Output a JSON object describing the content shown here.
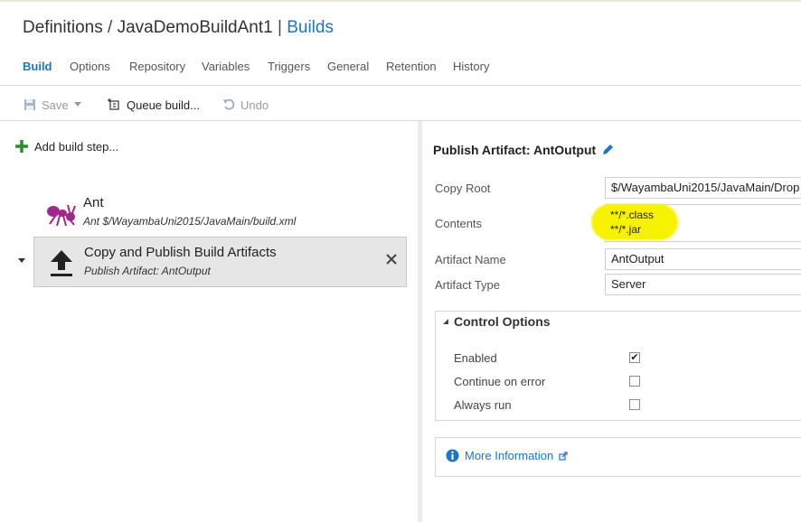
{
  "breadcrumb": {
    "root": "Definitions",
    "separator": "/",
    "definition": "JavaDemoBuildAnt1",
    "divider": "|",
    "builds_link": "Builds"
  },
  "tabs": [
    {
      "label": "Build",
      "active": true
    },
    {
      "label": "Options"
    },
    {
      "label": "Repository"
    },
    {
      "label": "Variables"
    },
    {
      "label": "Triggers"
    },
    {
      "label": "General"
    },
    {
      "label": "Retention"
    },
    {
      "label": "History"
    }
  ],
  "toolbar": {
    "save_label": "Save",
    "queue_label": "Queue build...",
    "undo_label": "Undo"
  },
  "left": {
    "add_step_label": "Add build step...",
    "steps": [
      {
        "title": "Ant",
        "subtitle": "Ant $/WayambaUni2015/JavaMain/build.xml",
        "icon": "ant-icon"
      },
      {
        "title": "Copy and Publish Build Artifacts",
        "subtitle": "Publish Artifact: AntOutput",
        "icon": "upload-icon",
        "selected": true
      }
    ]
  },
  "right": {
    "title": "Publish Artifact: AntOutput",
    "fields": {
      "copy_root_label": "Copy Root",
      "copy_root_value": "$/WayambaUni2015/JavaMain/Drop",
      "contents_label": "Contents",
      "contents_line1": "**/*.class",
      "contents_line2": "**/*.jar",
      "artifact_name_label": "Artifact Name",
      "artifact_name_value": "AntOutput",
      "artifact_type_label": "Artifact Type",
      "artifact_type_value": "Server"
    },
    "control_options": {
      "title": "Control Options",
      "enabled_label": "Enabled",
      "enabled_checked": true,
      "continue_label": "Continue on error",
      "continue_checked": false,
      "always_label": "Always run",
      "always_checked": false
    },
    "more_info_label": "More Information"
  },
  "colors": {
    "accent": "#1e74c5",
    "highlight": "#f7f200",
    "ant_icon": "#a0288c",
    "add_icon": "#2e8b2e"
  }
}
